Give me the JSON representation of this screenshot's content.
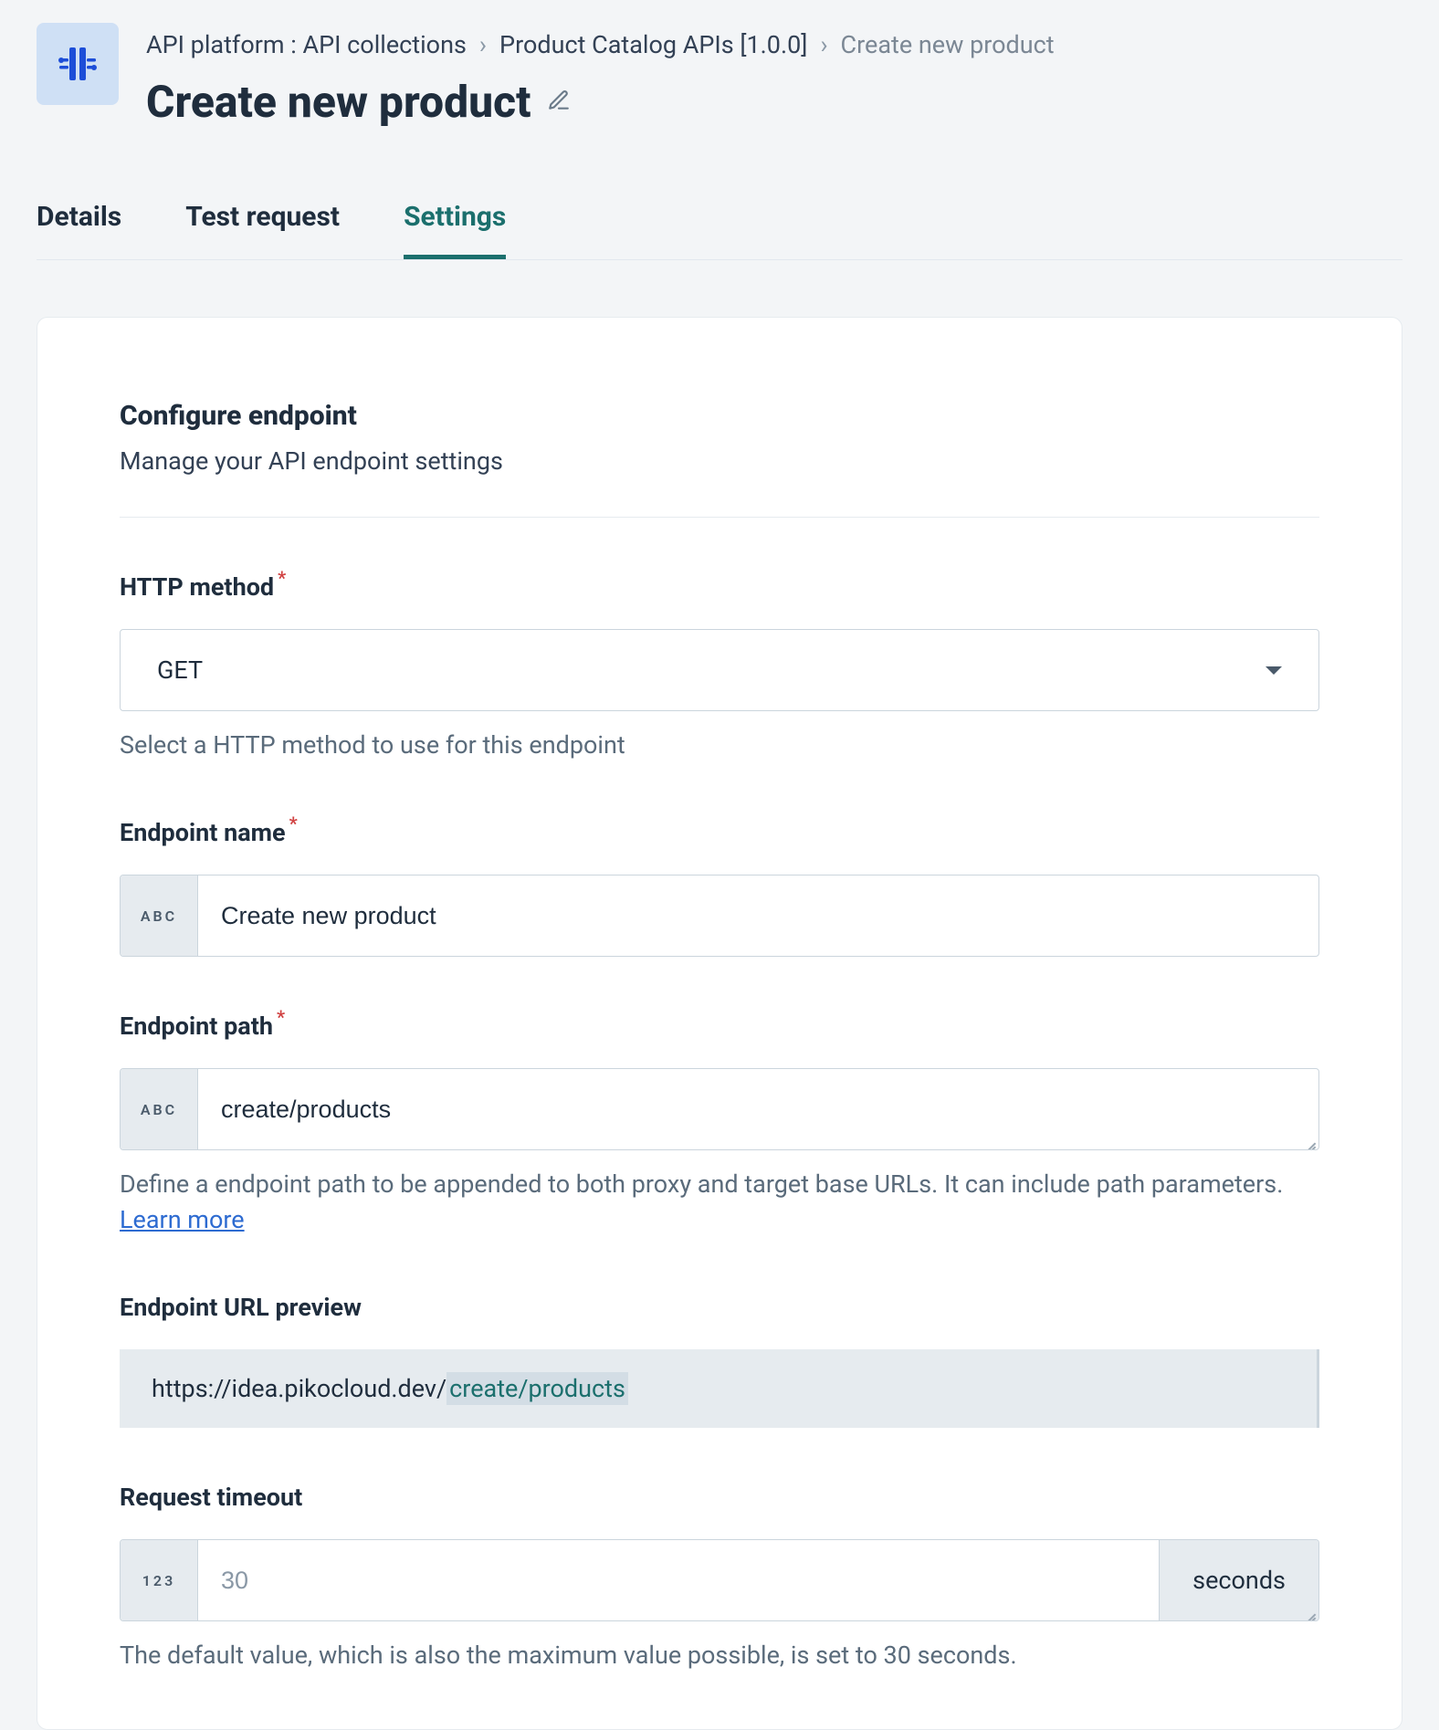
{
  "breadcrumb": {
    "root": "API platform : API collections",
    "mid": "Product Catalog APIs [1.0.0]",
    "current": "Create new product"
  },
  "pageTitle": "Create new product",
  "tabs": {
    "details": "Details",
    "testRequest": "Test request",
    "settings": "Settings"
  },
  "section": {
    "title": "Configure endpoint",
    "subtitle": "Manage your API endpoint settings"
  },
  "httpMethod": {
    "label": "HTTP method",
    "value": "GET",
    "help": "Select a HTTP method to use for this endpoint"
  },
  "endpointName": {
    "label": "Endpoint name",
    "addon": "ABC",
    "value": "Create new product"
  },
  "endpointPath": {
    "label": "Endpoint path",
    "addon": "ABC",
    "value": "create/products",
    "help": "Define a endpoint path to be appended to both proxy and target base URLs. It can include path parameters.",
    "learnMore": "Learn more"
  },
  "urlPreview": {
    "label": "Endpoint URL preview",
    "base": "https://idea.pikocloud.dev/",
    "highlight": "create/products"
  },
  "requestTimeout": {
    "label": "Request timeout",
    "addon": "123",
    "placeholder": "30",
    "unit": "seconds",
    "help": "The default value, which is also the maximum value possible, is set to 30 seconds."
  }
}
